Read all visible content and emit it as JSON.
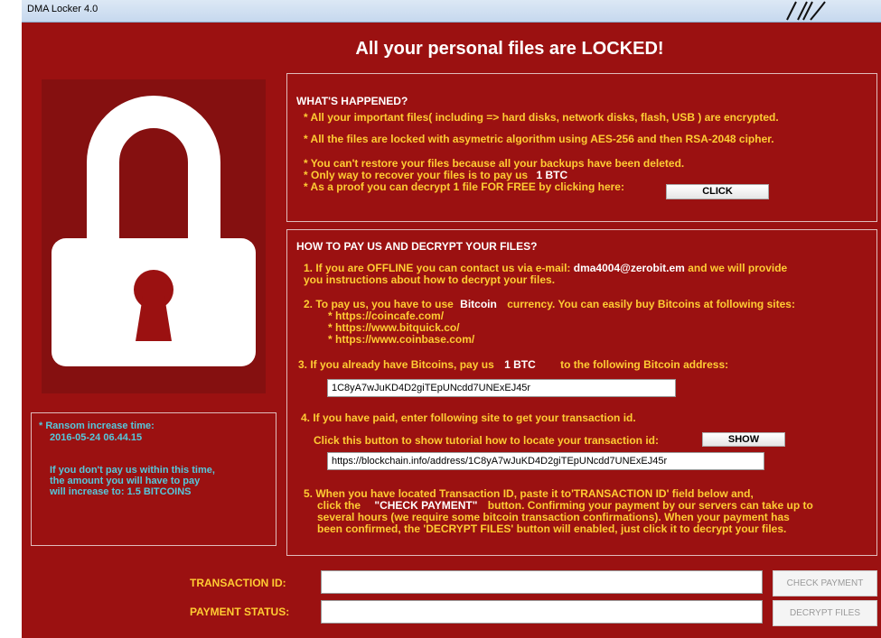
{
  "window": {
    "title": "DMA Locker 4.0"
  },
  "headline": "All your personal files are LOCKED!",
  "timer": {
    "label": "* Ransom increase time:",
    "datetime": "2016-05-24 06.44.15",
    "line1": "If you don't pay us within this time,",
    "line2": "the amount you will have to pay",
    "line3": "will increase to:  1.5 BITCOINS"
  },
  "happened": {
    "heading": "WHAT'S HAPPENED?",
    "l1": "* All your important files( including => hard disks, network disks, flash, USB ) are encrypted.",
    "l2": "* All the files are locked with asymetric algorithm using AES-256 and then RSA-2048 cipher.",
    "l3": "* You can't restore your files because all your backups have been deleted.",
    "l4a": "* Only way to recover your files is to pay us",
    "l4b": "1 BTC",
    "l5": "* As a proof you can decrypt 1 file FOR FREE by clicking here:",
    "click_label": "CLICK"
  },
  "howto": {
    "heading": "HOW TO PAY US AND DECRYPT YOUR FILES?",
    "s1a": "1. If you are OFFLINE you can contact us via e-mail:",
    "email": "dma4004@zerobit.em",
    "s1b": "and we will provide",
    "s1c": "you instructions about how to decrypt your files.",
    "s2a": "2. To pay us, you have to use",
    "currency": "Bitcoin",
    "s2b": "currency. You can easily buy Bitcoins at following sites:",
    "sites": [
      "* https://coincafe.com/",
      "* https://www.bitquick.co/",
      "* https://www.coinbase.com/"
    ],
    "s3a": "3. If you already have Bitcoins, pay us",
    "amount": "1 BTC",
    "s3b": "to the following Bitcoin address:",
    "address": "1C8yA7wJuKD4D2giTEpUNcdd7UNExEJ45r",
    "s4": "4. If you have paid, enter following site to get your transaction id.",
    "s4b": "Click this button to show tutorial how to locate your transaction id:",
    "show_label": "SHOW",
    "url": "https://blockchain.info/address/1C8yA7wJuKD4D2giTEpUNcdd7UNExEJ45r",
    "s5a": "5. When you have located Transaction ID, paste it to'TRANSACTION ID' field below and,",
    "s5b1": "click the",
    "s5b_btn": "\"CHECK PAYMENT\"",
    "s5b2": "button. Confirming your payment by our servers can take up to",
    "s5c": "several hours (we require some bitcoin transaction confirmations). When your payment has",
    "s5d": "been confirmed, the 'DECRYPT FILES' button will enabled, just click it to decrypt your files."
  },
  "form": {
    "txid_label": "TRANSACTION ID:",
    "txid_value": "",
    "status_label": "PAYMENT STATUS:",
    "status_value": "",
    "check_label": "CHECK PAYMENT",
    "decrypt_label": "DECRYPT FILES"
  },
  "icons": {
    "padlock": "padlock-icon"
  },
  "colors": {
    "background": "#9b1111",
    "accent_yellow": "#ffcc33",
    "timer_cyan": "#55c8dc"
  }
}
